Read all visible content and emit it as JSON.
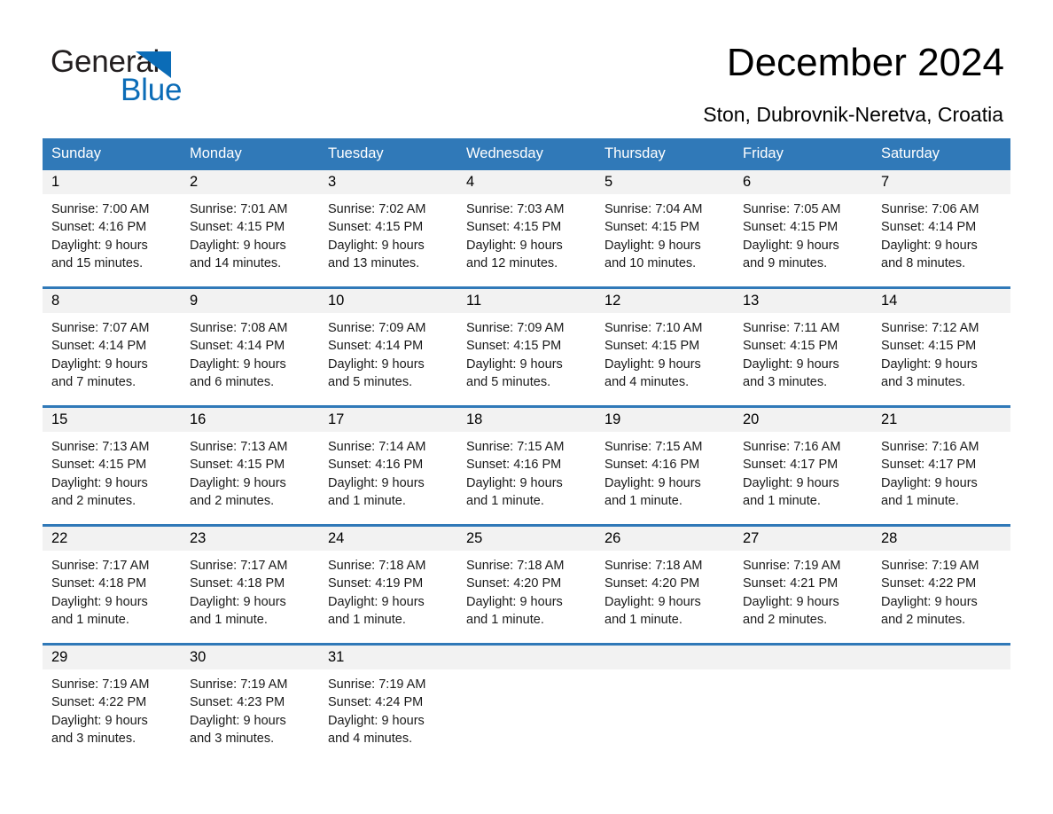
{
  "brand": {
    "name_part1": "General",
    "name_part2": "Blue",
    "triangle_color": "#0b6cb7",
    "text_color": "#231f20",
    "icon": "triangle-logo-icon"
  },
  "header": {
    "title": "December 2024",
    "subtitle": "Ston, Dubrovnik-Neretva, Croatia"
  },
  "theme": {
    "header_bg": "#3079b8",
    "header_text": "#ffffff",
    "daynum_band_bg": "#f2f2f2",
    "row_border": "#3079b8",
    "body_text": "#1a1a1a"
  },
  "calendar": {
    "weekday_headers": [
      "Sunday",
      "Monday",
      "Tuesday",
      "Wednesday",
      "Thursday",
      "Friday",
      "Saturday"
    ],
    "weeks": [
      [
        {
          "day": "1",
          "sunrise": "Sunrise: 7:00 AM",
          "sunset": "Sunset: 4:16 PM",
          "daylight_line1": "Daylight: 9 hours",
          "daylight_line2": "and 15 minutes."
        },
        {
          "day": "2",
          "sunrise": "Sunrise: 7:01 AM",
          "sunset": "Sunset: 4:15 PM",
          "daylight_line1": "Daylight: 9 hours",
          "daylight_line2": "and 14 minutes."
        },
        {
          "day": "3",
          "sunrise": "Sunrise: 7:02 AM",
          "sunset": "Sunset: 4:15 PM",
          "daylight_line1": "Daylight: 9 hours",
          "daylight_line2": "and 13 minutes."
        },
        {
          "day": "4",
          "sunrise": "Sunrise: 7:03 AM",
          "sunset": "Sunset: 4:15 PM",
          "daylight_line1": "Daylight: 9 hours",
          "daylight_line2": "and 12 minutes."
        },
        {
          "day": "5",
          "sunrise": "Sunrise: 7:04 AM",
          "sunset": "Sunset: 4:15 PM",
          "daylight_line1": "Daylight: 9 hours",
          "daylight_line2": "and 10 minutes."
        },
        {
          "day": "6",
          "sunrise": "Sunrise: 7:05 AM",
          "sunset": "Sunset: 4:15 PM",
          "daylight_line1": "Daylight: 9 hours",
          "daylight_line2": "and 9 minutes."
        },
        {
          "day": "7",
          "sunrise": "Sunrise: 7:06 AM",
          "sunset": "Sunset: 4:14 PM",
          "daylight_line1": "Daylight: 9 hours",
          "daylight_line2": "and 8 minutes."
        }
      ],
      [
        {
          "day": "8",
          "sunrise": "Sunrise: 7:07 AM",
          "sunset": "Sunset: 4:14 PM",
          "daylight_line1": "Daylight: 9 hours",
          "daylight_line2": "and 7 minutes."
        },
        {
          "day": "9",
          "sunrise": "Sunrise: 7:08 AM",
          "sunset": "Sunset: 4:14 PM",
          "daylight_line1": "Daylight: 9 hours",
          "daylight_line2": "and 6 minutes."
        },
        {
          "day": "10",
          "sunrise": "Sunrise: 7:09 AM",
          "sunset": "Sunset: 4:14 PM",
          "daylight_line1": "Daylight: 9 hours",
          "daylight_line2": "and 5 minutes."
        },
        {
          "day": "11",
          "sunrise": "Sunrise: 7:09 AM",
          "sunset": "Sunset: 4:15 PM",
          "daylight_line1": "Daylight: 9 hours",
          "daylight_line2": "and 5 minutes."
        },
        {
          "day": "12",
          "sunrise": "Sunrise: 7:10 AM",
          "sunset": "Sunset: 4:15 PM",
          "daylight_line1": "Daylight: 9 hours",
          "daylight_line2": "and 4 minutes."
        },
        {
          "day": "13",
          "sunrise": "Sunrise: 7:11 AM",
          "sunset": "Sunset: 4:15 PM",
          "daylight_line1": "Daylight: 9 hours",
          "daylight_line2": "and 3 minutes."
        },
        {
          "day": "14",
          "sunrise": "Sunrise: 7:12 AM",
          "sunset": "Sunset: 4:15 PM",
          "daylight_line1": "Daylight: 9 hours",
          "daylight_line2": "and 3 minutes."
        }
      ],
      [
        {
          "day": "15",
          "sunrise": "Sunrise: 7:13 AM",
          "sunset": "Sunset: 4:15 PM",
          "daylight_line1": "Daylight: 9 hours",
          "daylight_line2": "and 2 minutes."
        },
        {
          "day": "16",
          "sunrise": "Sunrise: 7:13 AM",
          "sunset": "Sunset: 4:15 PM",
          "daylight_line1": "Daylight: 9 hours",
          "daylight_line2": "and 2 minutes."
        },
        {
          "day": "17",
          "sunrise": "Sunrise: 7:14 AM",
          "sunset": "Sunset: 4:16 PM",
          "daylight_line1": "Daylight: 9 hours",
          "daylight_line2": "and 1 minute."
        },
        {
          "day": "18",
          "sunrise": "Sunrise: 7:15 AM",
          "sunset": "Sunset: 4:16 PM",
          "daylight_line1": "Daylight: 9 hours",
          "daylight_line2": "and 1 minute."
        },
        {
          "day": "19",
          "sunrise": "Sunrise: 7:15 AM",
          "sunset": "Sunset: 4:16 PM",
          "daylight_line1": "Daylight: 9 hours",
          "daylight_line2": "and 1 minute."
        },
        {
          "day": "20",
          "sunrise": "Sunrise: 7:16 AM",
          "sunset": "Sunset: 4:17 PM",
          "daylight_line1": "Daylight: 9 hours",
          "daylight_line2": "and 1 minute."
        },
        {
          "day": "21",
          "sunrise": "Sunrise: 7:16 AM",
          "sunset": "Sunset: 4:17 PM",
          "daylight_line1": "Daylight: 9 hours",
          "daylight_line2": "and 1 minute."
        }
      ],
      [
        {
          "day": "22",
          "sunrise": "Sunrise: 7:17 AM",
          "sunset": "Sunset: 4:18 PM",
          "daylight_line1": "Daylight: 9 hours",
          "daylight_line2": "and 1 minute."
        },
        {
          "day": "23",
          "sunrise": "Sunrise: 7:17 AM",
          "sunset": "Sunset: 4:18 PM",
          "daylight_line1": "Daylight: 9 hours",
          "daylight_line2": "and 1 minute."
        },
        {
          "day": "24",
          "sunrise": "Sunrise: 7:18 AM",
          "sunset": "Sunset: 4:19 PM",
          "daylight_line1": "Daylight: 9 hours",
          "daylight_line2": "and 1 minute."
        },
        {
          "day": "25",
          "sunrise": "Sunrise: 7:18 AM",
          "sunset": "Sunset: 4:20 PM",
          "daylight_line1": "Daylight: 9 hours",
          "daylight_line2": "and 1 minute."
        },
        {
          "day": "26",
          "sunrise": "Sunrise: 7:18 AM",
          "sunset": "Sunset: 4:20 PM",
          "daylight_line1": "Daylight: 9 hours",
          "daylight_line2": "and 1 minute."
        },
        {
          "day": "27",
          "sunrise": "Sunrise: 7:19 AM",
          "sunset": "Sunset: 4:21 PM",
          "daylight_line1": "Daylight: 9 hours",
          "daylight_line2": "and 2 minutes."
        },
        {
          "day": "28",
          "sunrise": "Sunrise: 7:19 AM",
          "sunset": "Sunset: 4:22 PM",
          "daylight_line1": "Daylight: 9 hours",
          "daylight_line2": "and 2 minutes."
        }
      ],
      [
        {
          "day": "29",
          "sunrise": "Sunrise: 7:19 AM",
          "sunset": "Sunset: 4:22 PM",
          "daylight_line1": "Daylight: 9 hours",
          "daylight_line2": "and 3 minutes."
        },
        {
          "day": "30",
          "sunrise": "Sunrise: 7:19 AM",
          "sunset": "Sunset: 4:23 PM",
          "daylight_line1": "Daylight: 9 hours",
          "daylight_line2": "and 3 minutes."
        },
        {
          "day": "31",
          "sunrise": "Sunrise: 7:19 AM",
          "sunset": "Sunset: 4:24 PM",
          "daylight_line1": "Daylight: 9 hours",
          "daylight_line2": "and 4 minutes."
        },
        {
          "day": "",
          "sunrise": "",
          "sunset": "",
          "daylight_line1": "",
          "daylight_line2": ""
        },
        {
          "day": "",
          "sunrise": "",
          "sunset": "",
          "daylight_line1": "",
          "daylight_line2": ""
        },
        {
          "day": "",
          "sunrise": "",
          "sunset": "",
          "daylight_line1": "",
          "daylight_line2": ""
        },
        {
          "day": "",
          "sunrise": "",
          "sunset": "",
          "daylight_line1": "",
          "daylight_line2": ""
        }
      ]
    ]
  }
}
